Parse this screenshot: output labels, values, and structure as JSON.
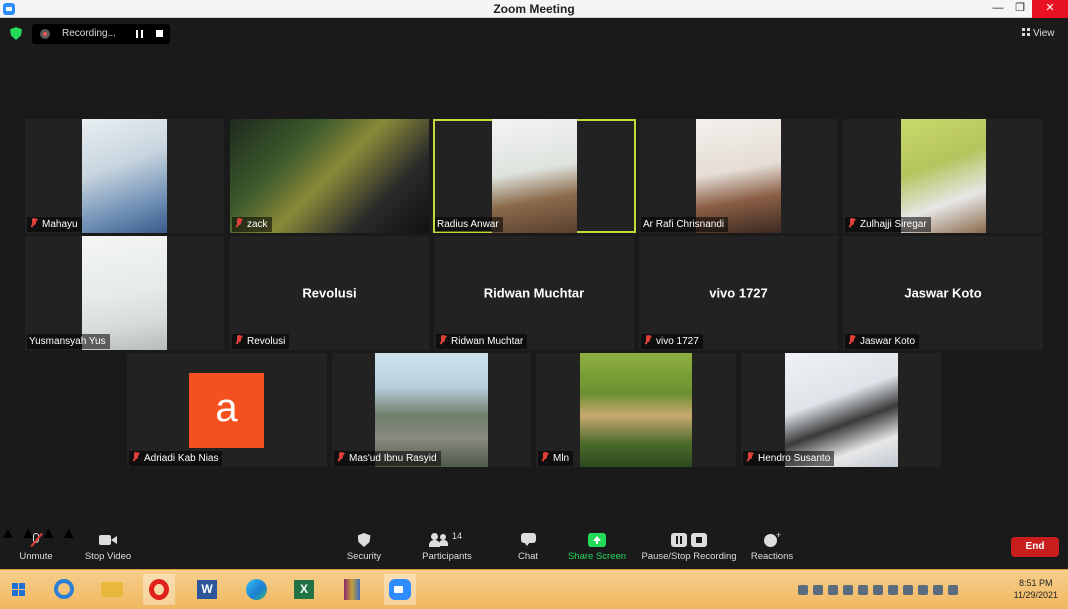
{
  "window": {
    "title": "Zoom Meeting",
    "minimize_icon": "minimize-icon",
    "restore_icon": "restore-icon",
    "close_icon": "close-icon"
  },
  "meeting_bar": {
    "recording_label": "Recording...",
    "view_label": "View",
    "shield_color": "#23d959"
  },
  "participants": [
    {
      "name": "Mahayu",
      "muted": true,
      "video": true
    },
    {
      "name": "zack",
      "muted": true,
      "video": true
    },
    {
      "name": "Radius  Anwar",
      "muted": false,
      "video": true,
      "active_speaker": true
    },
    {
      "name": "Ar Rafi Chrisnandi",
      "muted": false,
      "video": true
    },
    {
      "name": "Zulhajji Siregar",
      "muted": true,
      "video": true
    },
    {
      "name": "Yusmansyah Yus",
      "muted": false,
      "video": true
    },
    {
      "name": "Revolusi",
      "display": "Revolusi",
      "muted": true,
      "video": false
    },
    {
      "name": "Ridwan Muchtar",
      "display": "Ridwan Muchtar",
      "muted": true,
      "video": false
    },
    {
      "name": "vivo 1727",
      "display": "vivo 1727",
      "muted": true,
      "video": false
    },
    {
      "name": "Jaswar Koto",
      "display": "Jaswar Koto",
      "muted": true,
      "video": false
    },
    {
      "name": "Adriadi Kab Nias",
      "muted": true,
      "video": false,
      "avatar_letter": "a",
      "avatar_color": "#f4511e"
    },
    {
      "name": "Mas'ud Ibnu Rasyid",
      "muted": true,
      "video": true
    },
    {
      "name": "Mln",
      "muted": true,
      "video": true
    },
    {
      "name": "Hendro Susanto",
      "muted": true,
      "video": true
    }
  ],
  "toolbar": {
    "unmute": "Unmute",
    "stop_video": "Stop Video",
    "security": "Security",
    "participants": "Participants",
    "participants_count": "14",
    "chat": "Chat",
    "share_screen": "Share Screen",
    "pause_stop_recording": "Pause/Stop Recording",
    "reactions": "Reactions",
    "end": "End",
    "end_color": "#c81e1e",
    "share_color": "#23d959"
  },
  "taskbar": {
    "apps": [
      "windows-start-icon",
      "internet-explorer-icon",
      "file-explorer-icon",
      "opera-icon",
      "word-icon",
      "edge-icon",
      "excel-icon",
      "winrar-icon",
      "zoom-icon"
    ],
    "time": "8:51 PM",
    "date": "11/29/2021"
  }
}
